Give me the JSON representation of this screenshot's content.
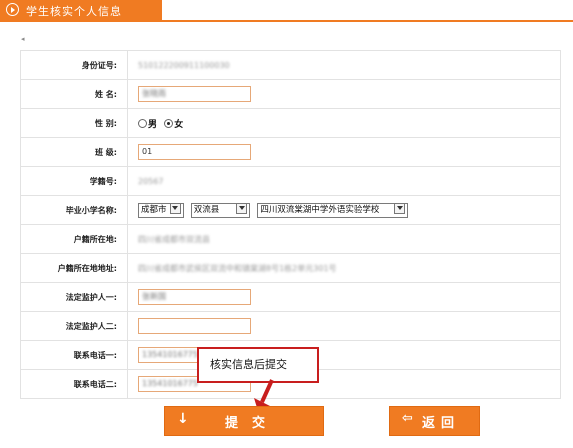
{
  "header": {
    "title": "学生核实个人信息"
  },
  "nav": {
    "back_arrow": "◂"
  },
  "form": {
    "id_number": {
      "label": "身份证号:",
      "value": "510122200911100030"
    },
    "name": {
      "label": "姓    名:",
      "value": "张晓雨"
    },
    "gender": {
      "label": "性    别:",
      "options": [
        "男",
        "女"
      ],
      "selected": "女"
    },
    "class": {
      "label": "班    级:",
      "value": "01"
    },
    "student_no": {
      "label": "学籍号:",
      "value": "20567"
    },
    "primary_school": {
      "label": "毕业小学名称:",
      "city": "成都市",
      "county": "双流县",
      "school": "四川双流棠湖中学外语实验学校"
    },
    "hukou": {
      "label": "户籍所在地:",
      "value": "四川省成都市双流县"
    },
    "hukou_address": {
      "label": "户籍所在地地址:",
      "value": "四川省成都市武侯区双流中和镇棠湖8号1栋2单元301号"
    },
    "guardian1": {
      "label": "法定监护人一:",
      "value": "张新国"
    },
    "guardian2": {
      "label": "法定监护人二:",
      "value": ""
    },
    "phone1": {
      "label": "联系电话一:",
      "value": "13541016775"
    },
    "phone2": {
      "label": "联系电话二:",
      "value": "13541016775"
    }
  },
  "callout": {
    "text": "核实信息后提交"
  },
  "buttons": {
    "submit": "提交",
    "submit_icon": "↓",
    "back": "返回",
    "back_icon": "⇦"
  },
  "colors": {
    "accent": "#f07b22",
    "callout_border": "#c81e1e"
  }
}
